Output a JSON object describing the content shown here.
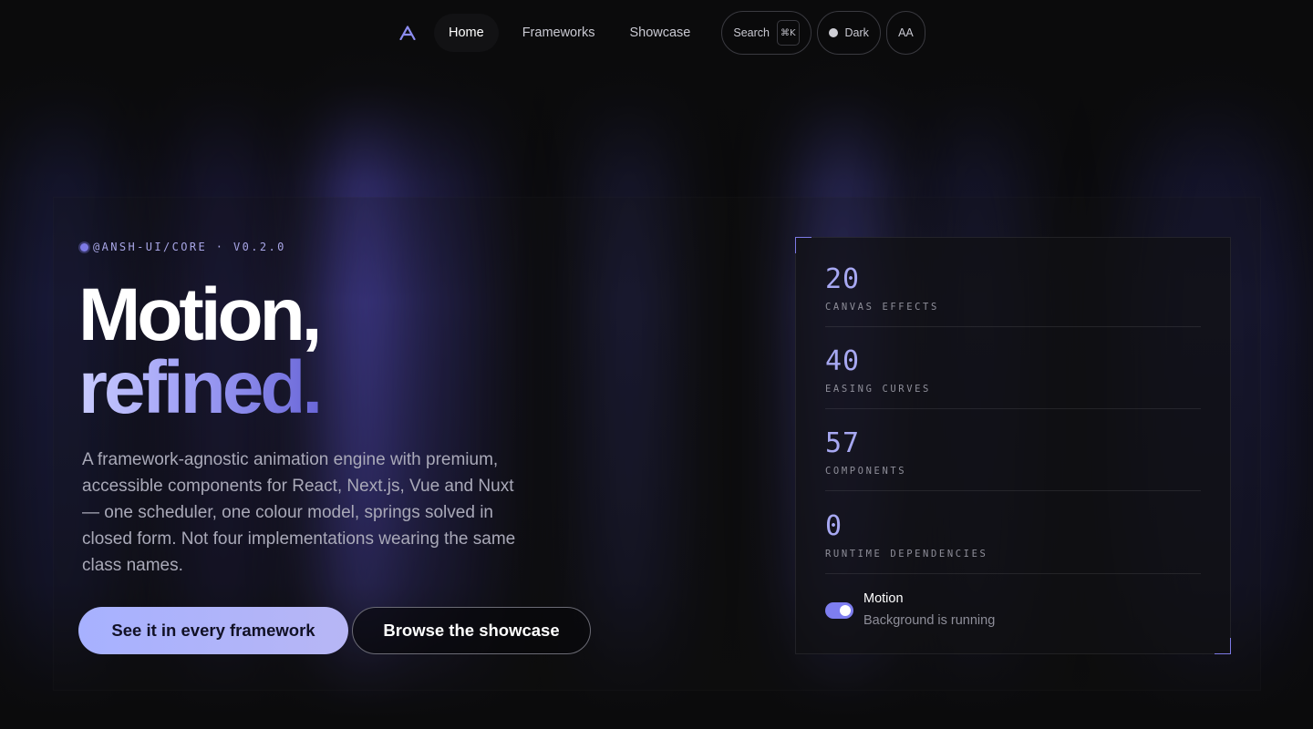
{
  "nav": {
    "logo_icon": "a-logo-icon",
    "links": [
      {
        "label": "Home",
        "active": true
      },
      {
        "label": "Frameworks",
        "active": false
      },
      {
        "label": "Showcase",
        "active": false
      }
    ],
    "search_label": "Search",
    "search_shortcut": "⌘K",
    "theme_label": "Dark",
    "text_size_label": "AA"
  },
  "hero": {
    "eyebrow": "@ANSH-UI/CORE · V0.2.0",
    "headline_line1": "Motion,",
    "headline_line2": "refined.",
    "description": "A framework-agnostic animation engine with premium, accessible components for React, Next.js, Vue and Nuxt — one scheduler, one colour model, springs solved in closed form. Not four implementations wearing the same class names.",
    "primary_button": "See it in every framework",
    "secondary_button": "Browse the showcase"
  },
  "stats": [
    {
      "value": "20",
      "label": "CANVAS EFFECTS"
    },
    {
      "value": "40",
      "label": "EASING CURVES"
    },
    {
      "value": "57",
      "label": "COMPONENTS"
    },
    {
      "value": "0",
      "label": "RUNTIME DEPENDENCIES"
    }
  ],
  "motion_toggle": {
    "title": "Motion",
    "status": "Background is running",
    "enabled": true
  },
  "colors": {
    "accent": "#7d7ae6",
    "background": "#0b0b0c",
    "primary_button": "#a7b1ff"
  }
}
